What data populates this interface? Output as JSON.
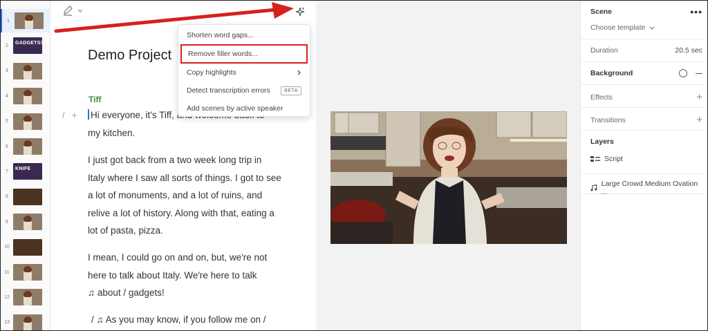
{
  "thumbnails": [
    {
      "num": "1",
      "kind": "person",
      "active": true
    },
    {
      "num": "2",
      "kind": "text",
      "text": "GADGETS!"
    },
    {
      "num": "3",
      "kind": "person"
    },
    {
      "num": "4",
      "kind": "person"
    },
    {
      "num": "5",
      "kind": "person"
    },
    {
      "num": "6",
      "kind": "person"
    },
    {
      "num": "7",
      "kind": "text",
      "text": "KNIFE"
    },
    {
      "num": "8",
      "kind": "dark"
    },
    {
      "num": "9",
      "kind": "person"
    },
    {
      "num": "10",
      "kind": "dark"
    },
    {
      "num": "11",
      "kind": "person"
    },
    {
      "num": "12",
      "kind": "person"
    },
    {
      "num": "13",
      "kind": "person"
    }
  ],
  "editor": {
    "project_title": "Demo Project",
    "speaker": "Tiff",
    "gutter_slash": "/",
    "gutter_plus": "+",
    "p1_a": "Hi everyone, it's Tiff, and welcome back to",
    "p1_b": "my kitchen.",
    "p2": [
      "I just got back from a two week long trip in",
      "Italy where I saw all sorts of things. I got to see",
      "a lot of monuments, and a lot of ruins, and",
      "relive a lot of history. Along with that, eating a",
      "lot of pasta, pizza."
    ],
    "p3": [
      "I mean, I could go on and on, but, we're not",
      "here to talk about Italy. We're here to talk",
      "♫ about / gadgets!"
    ],
    "p4": "/ ♫ As you may know, if you follow me on /"
  },
  "menu": {
    "items": [
      {
        "label": "Shorten word gaps..."
      },
      {
        "label": "Remove filler words...",
        "highlighted": true
      },
      {
        "label": "Copy highlights",
        "has_submenu": true
      },
      {
        "label": "Detect transcription errors",
        "badge": "BETA"
      },
      {
        "label": "Add scenes by active speaker"
      }
    ]
  },
  "panel": {
    "scene_label": "Scene",
    "more": "•••",
    "template_label": "Choose template",
    "duration_label": "Duration",
    "duration_value": "20.5 sec",
    "background_label": "Background",
    "effects_label": "Effects",
    "transitions_label": "Transitions",
    "layers_label": "Layers",
    "layer_script": "Script",
    "layer_audio": "Large Crowd Medium Ovation ..."
  },
  "colors": {
    "accent": "#2f6fdd",
    "annotation_red": "#d6201f",
    "speaker_green": "#3c8a3c"
  }
}
